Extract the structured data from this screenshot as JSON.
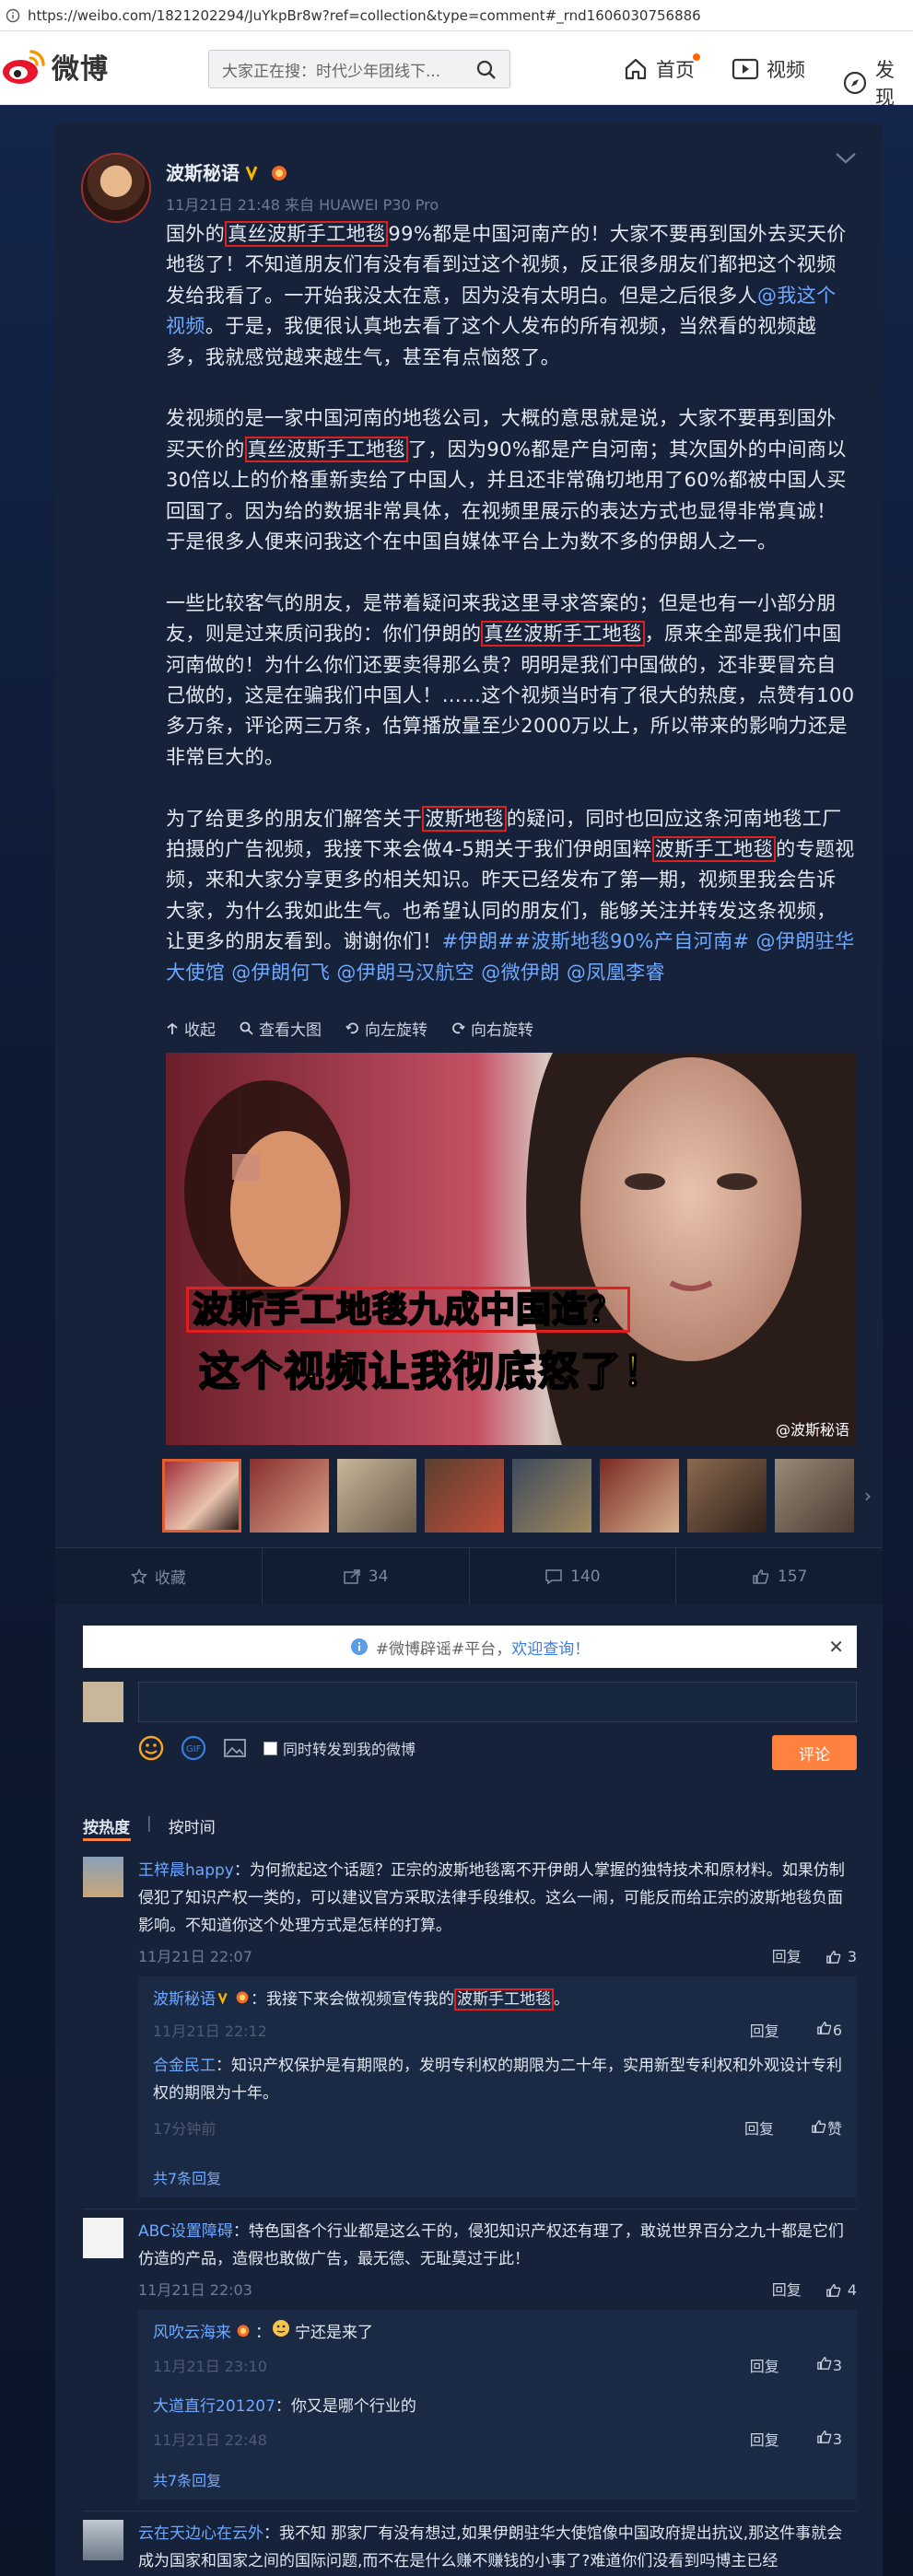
{
  "browser": {
    "url": "https://weibo.com/1821202294/JuYkpBr8w?ref=collection&type=comment#_rnd1606030756886"
  },
  "header": {
    "logo_text": "微博",
    "search_placeholder": "大家正在搜：时代少年团线下...",
    "nav": [
      {
        "label": "首页",
        "icon": "home-icon"
      },
      {
        "label": "视频",
        "icon": "video-icon"
      },
      {
        "label": "发现",
        "icon": "compass-icon"
      }
    ]
  },
  "post": {
    "author": "波斯秘语",
    "meta": "11月21日 21:48 来自 HUAWEI P30 Pro",
    "p1": [
      "国外的",
      "真丝波斯手工地毯",
      "99%都是中国河南产的！大家不要再到国外去买天价地毯了！不知道朋友们有没有看到过这个视频，反正很多朋友们都把这个视频发给我看了。一开始我没太在意，因为没有太明白。但是之后很多人",
      "@我这个视频",
      "。于是，我便很认真地去看了这个人发布的所有视频，当然看的视频越多，我就感觉越来越生气，甚至有点恼怒了。"
    ],
    "p2": [
      "发视频的是一家中国河南的地毯公司，大概的意思就是说，大家不要再到国外买天价的",
      "真丝波斯手工地毯",
      "了，因为90%都是产自河南；其次国外的中间商以30倍以上的价格重新卖给了中国人，并且还非常确切地用了60%都被中国人买回国了。因为给的数据非常具体，在视频里展示的表达方式也显得非常真诚！于是很多人便来问我这个在中国自媒体平台上为数不多的伊朗人之一。"
    ],
    "p3": [
      "一些比较客气的朋友，是带着疑问来我这里寻求答案的；但是也有一小部分朋友，则是过来质问我的：你们伊朗的",
      "真丝波斯手工地毯",
      "，原来全部是我们中国河南做的！为什么你们还要卖得那么贵？明明是我们中国做的，还非要冒充自己做的，这是在骗我们中国人！……这个视频当时有了很大的热度，点赞有100多万条，评论两三万条，估算播放量至少2000万以上，所以带来的影响力还是非常巨大的。"
    ],
    "p4": [
      "为了给更多的朋友们解答关于",
      "波斯地毯",
      "的疑问，同时也回应这条河南地毯工厂拍摄的广告视频，我接下来会做4-5期关于我们伊朗国粹",
      "波斯手工地毯",
      "的专题视频，来和大家分享更多的相关知识。昨天已经发布了第一期，视频里我会告诉大家，为什么我如此生气。也希望认同的朋友们，能够关注并转发这条视频，让更多的朋友看到。谢谢你们！",
      "#伊朗##波斯地毯90%产自河南# @伊朗驻华大使馆 @伊朗何飞 @伊朗马汉航空 @微伊朗 @凤凰李睿"
    ],
    "tools": [
      "收起",
      "查看大图",
      "向左旋转",
      "向右旋转"
    ],
    "image": {
      "line1": "波斯手工地毯九成中国造？",
      "line2": "这个视频让我彻底怒了！",
      "watermark": "@波斯秘语"
    }
  },
  "actions": {
    "fav": "收藏",
    "repost": "34",
    "comment": "140",
    "like": "157"
  },
  "notice": {
    "prefix": "#微博辟谣#平台，",
    "link": "欢迎查询！"
  },
  "composer": {
    "check_label": "同时转发到我的微博",
    "submit": "评论"
  },
  "sort": {
    "hot": "按热度",
    "time": "按时间"
  },
  "comments": [
    {
      "name": "王梓晨happy",
      "text": "：为何掀起这个话题？正宗的波斯地毯离不开伊朗人掌握的独特技术和原材料。如果仿制侵犯了知识产权一类的，可以建议官方采取法律手段维权。这么一闹，可能反而给正宗的波斯地毯负面影响。不知道你这个处理方式是怎样的打算。",
      "time": "11月21日 22:07",
      "reply_label": "回复",
      "likes": "3",
      "replies": [
        {
          "name": "波斯秘语",
          "pre": "：我接下来会做视频宣传我的",
          "hl": "波斯手工地毯",
          "post": "。",
          "time": "11月21日 22:12",
          "reply_label": "回复",
          "likes": "6"
        },
        {
          "name": "合金民工",
          "text": "：知识产权保护是有期限的，发明专利权的期限为二十年，实用新型专利权和外观设计专利权的期限为十年。",
          "time": "17分钟前",
          "reply_label": "回复",
          "likes": "赞"
        }
      ],
      "more": "共7条回复"
    },
    {
      "name": "ABC设置障碍",
      "text": "：特色国各个行业都是这么干的，侵犯知识产权还有理了，敢说世界百分之九十都是它们仿造的产品，造假也敢做广告，最无德、无耻莫过于此！",
      "time": "11月21日 22:03",
      "reply_label": "回复",
      "likes": "4",
      "replies": [
        {
          "name": "风吹云海来",
          "text": "宁还是来了",
          "time": "11月21日 23:10",
          "reply_label": "回复",
          "likes": "3"
        },
        {
          "name": "大道直行201207",
          "text": "：你又是哪个行业的",
          "time": "11月21日 22:48",
          "reply_label": "回复",
          "likes": "3"
        }
      ],
      "more": "共7条回复"
    },
    {
      "name": "云在天边心在云外",
      "text": "：我不知 那家厂有没有想过,如果伊朗驻华大使馆像中国政府提出抗议,那这件事就会成为国家和国家之间的国际问题,而不在是什么赚不赚钱的小事了?难道你们没看到吗博主已经"
    }
  ],
  "colors": {
    "accent": "#ff8140",
    "link": "#6fa8ff",
    "highlight_box": "#e02020",
    "card_bg": "#15223a"
  }
}
